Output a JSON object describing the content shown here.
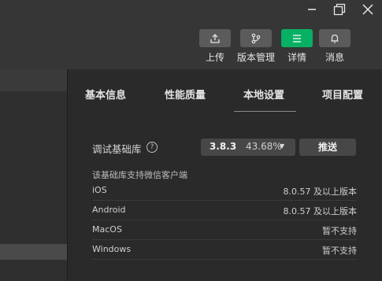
{
  "window_controls": {
    "minimize": "—",
    "maximize": "❐",
    "close": "✕"
  },
  "toolbar": [
    {
      "label": "上传",
      "icon": "upload-icon"
    },
    {
      "label": "版本管理",
      "icon": "branch-icon"
    },
    {
      "label": "详情",
      "icon": "menu-icon",
      "active": true
    },
    {
      "label": "消息",
      "icon": "bell-icon"
    }
  ],
  "tabs": [
    {
      "label": "基本信息"
    },
    {
      "label": "性能质量"
    },
    {
      "label": "本地设置",
      "active": true
    },
    {
      "label": "项目配置"
    }
  ],
  "settings": {
    "lib_label": "调试基础库",
    "help_glyph": "?",
    "version": "3.8.3",
    "percent": "43.68%",
    "caret": "▼",
    "push_label": "推送",
    "support_title": "该基础库支持微信客户端",
    "platforms": [
      {
        "name": "iOS",
        "value": "8.0.57 及以上版本"
      },
      {
        "name": "Android",
        "value": "8.0.57 及以上版本"
      },
      {
        "name": "MacOS",
        "value": "暂不支持"
      },
      {
        "name": "Windows",
        "value": "暂不支持"
      }
    ]
  },
  "colors": {
    "accent": "#07b062",
    "background": "#2a2a2a",
    "toolbar_bg": "#363636"
  }
}
